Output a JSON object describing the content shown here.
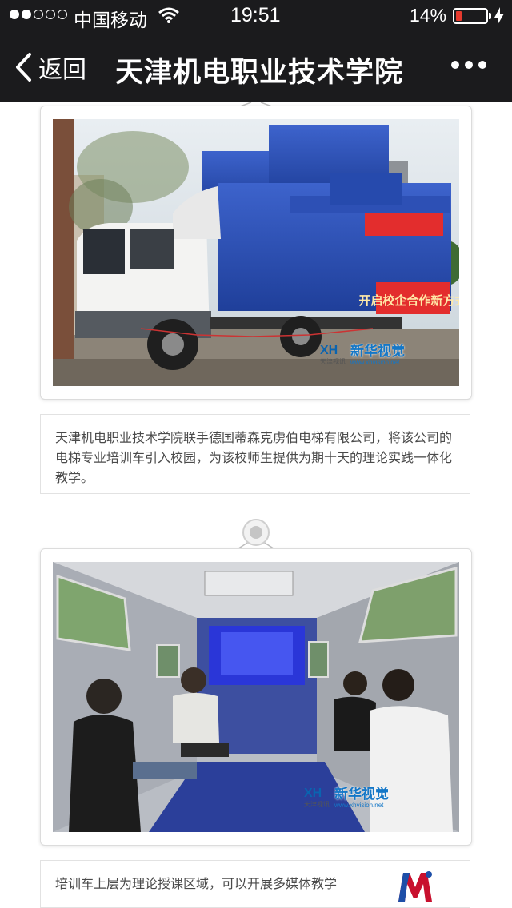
{
  "status_bar": {
    "carrier": "中国移动",
    "time": "19:51",
    "battery": "14%",
    "signal_bars": 2
  },
  "nav": {
    "back_label": "返回",
    "title": "天津机电职业技术学院"
  },
  "article": {
    "photos": [
      {
        "description_icon": "truck-photo",
        "watermark": {
          "brand": "新华视觉",
          "url": "www.xhvision.net",
          "sub": "天津视讯"
        },
        "banners": [
          "开启校企合作新方式"
        ]
      },
      {
        "description_icon": "classroom-photo",
        "watermark": {
          "brand": "新华视觉",
          "url": "www.xhvision.net",
          "sub": "天津视讯"
        }
      }
    ],
    "captions": [
      "天津机电职业技术学院联手德国蒂森克虏伯电梯有限公司，将该公司的电梯专业培训车引入校园，为该校师生提供为期十天的理论实践一体化教学。",
      "培训车上层为理论授课区域，可以开展多媒体教学"
    ]
  },
  "colors": {
    "bar_bg": "#1b1b1d",
    "battery_low": "#e63a2e",
    "caption_text": "#4a4a4a",
    "truck_blue": "#2b4fb8"
  }
}
